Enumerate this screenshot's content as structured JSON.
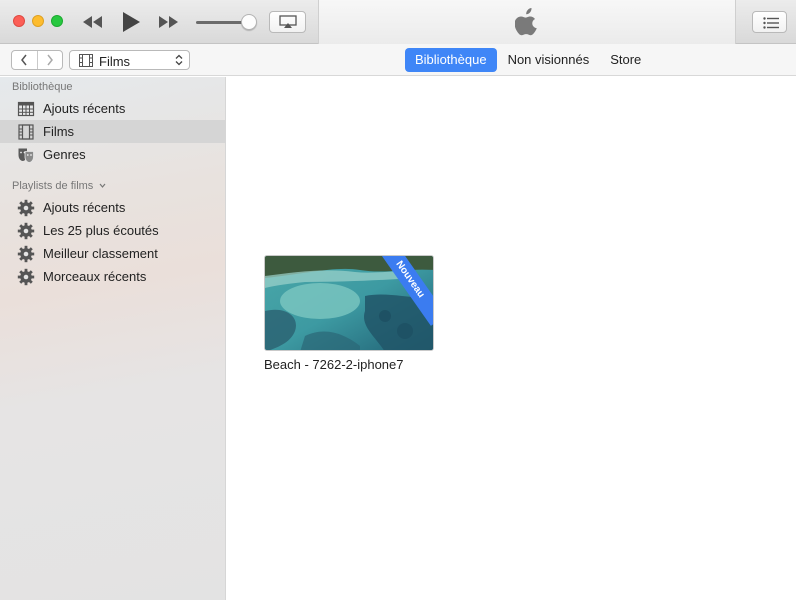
{
  "player": {
    "volume_level": 0.85,
    "icons": [
      "rewind-icon",
      "play-icon",
      "fast-forward-icon",
      "airplay-icon",
      "apple-logo",
      "list-icon"
    ]
  },
  "navbar": {
    "media_kind": "Films",
    "tabs": [
      {
        "label": "Bibliothèque",
        "active": true
      },
      {
        "label": "Non visionnés",
        "active": false
      },
      {
        "label": "Store",
        "active": false
      }
    ]
  },
  "sidebar": {
    "library_title": "Bibliothèque",
    "library_items": [
      {
        "label": "Ajouts récents",
        "icon": "grid-calendar-icon",
        "selected": false
      },
      {
        "label": "Films",
        "icon": "film-icon",
        "selected": true
      },
      {
        "label": "Genres",
        "icon": "theater-masks-icon",
        "selected": false
      }
    ],
    "playlists_title": "Playlists de films",
    "playlists": [
      {
        "label": "Ajouts récents",
        "icon": "gear-icon"
      },
      {
        "label": "Les 25 plus écoutés",
        "icon": "gear-icon"
      },
      {
        "label": "Meilleur classement",
        "icon": "gear-icon"
      },
      {
        "label": "Morceaux récents",
        "icon": "gear-icon"
      }
    ]
  },
  "content": {
    "movies": [
      {
        "title": "Beach - 7262-2-iphone7",
        "badge": "Nouveau"
      }
    ]
  },
  "colors": {
    "accent": "#3f86f7",
    "badge": "#3b7cf0",
    "close": "#fc5f57",
    "minimize": "#fdbc2e",
    "maximize": "#28c840"
  }
}
